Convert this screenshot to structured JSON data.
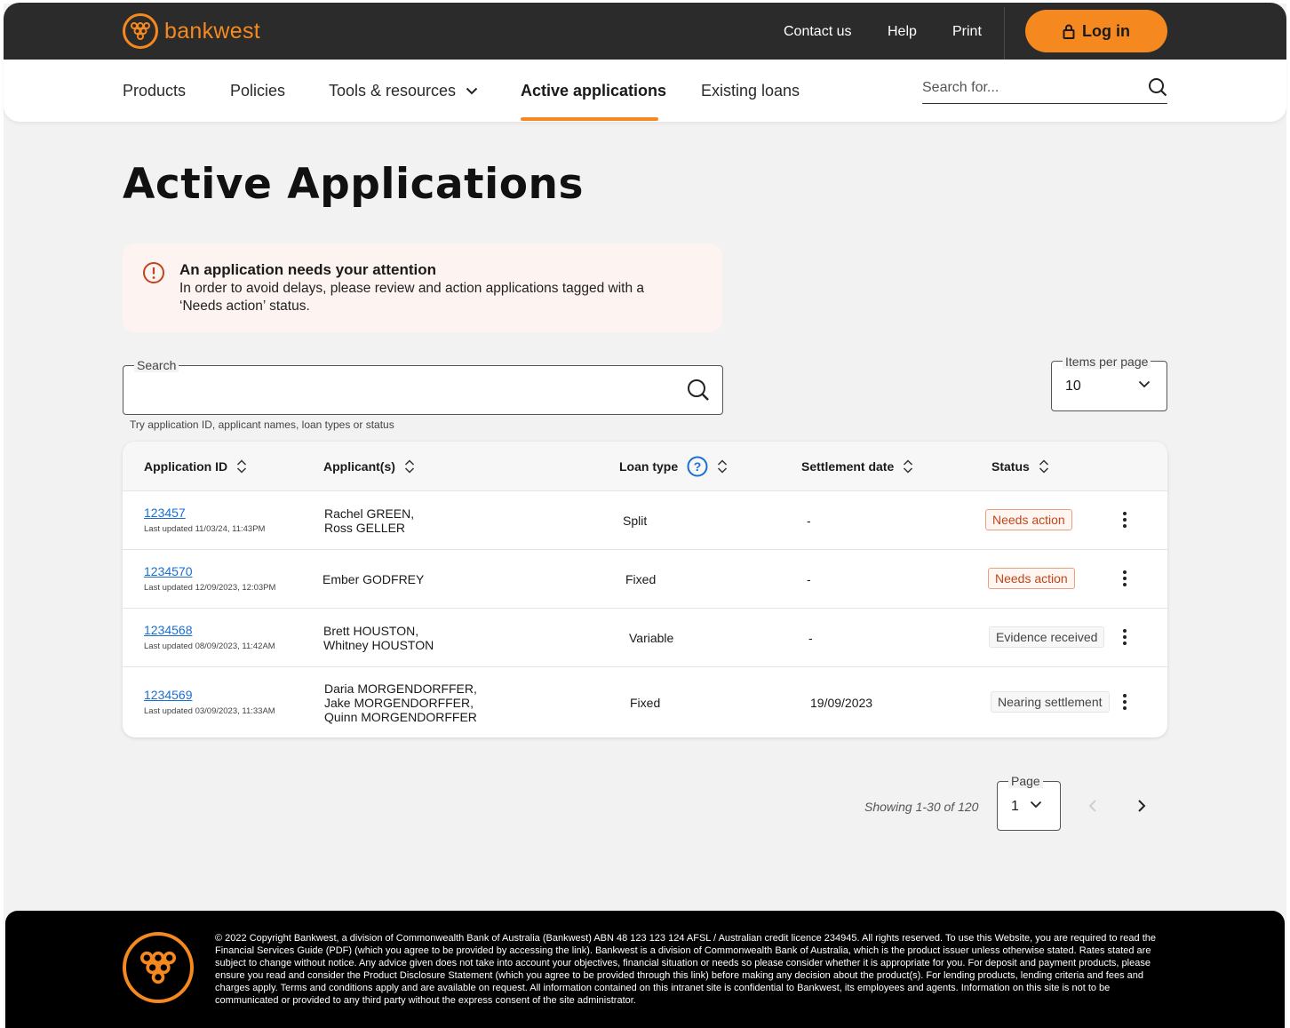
{
  "brand": {
    "name": "bankwest",
    "accent": "#f5891f"
  },
  "header": {
    "links": [
      "Contact us",
      "Help",
      "Print"
    ],
    "login_label": "Log in"
  },
  "nav": {
    "items": [
      "Products",
      "Policies",
      "Tools & resources",
      "Active applications",
      "Existing loans"
    ],
    "active": "Active applications",
    "search_placeholder": "Search for..."
  },
  "page_title": "Active Applications",
  "alert": {
    "title": "An application needs your attention",
    "body": "In order to avoid delays, please review and action applications tagged with a ‘Needs action’ status."
  },
  "search": {
    "label": "Search",
    "hint": "Try application ID, applicant names, loan types or status"
  },
  "items_per_page": {
    "label": "Items per page",
    "value": "10"
  },
  "table": {
    "headers": [
      "Application ID",
      "Applicant(s)",
      "Loan type",
      "Settlement date",
      "Status"
    ],
    "rows": [
      {
        "id": "123457",
        "updated": "Last updated 11/03/24, 11:43PM",
        "applicants": "Rachel GREEN,\nRoss GELLER",
        "loan_type": "Split",
        "settlement": "-",
        "status": "Needs action"
      },
      {
        "id": "1234570",
        "updated": "Last updated 12/09/2023, 12:03PM",
        "applicants": "Ember GODFREY",
        "loan_type": "Fixed",
        "settlement": "-",
        "status": "Needs action"
      },
      {
        "id": "1234568",
        "updated": "Last updated 08/09/2023, 11:42AM",
        "applicants": "Brett HOUSTON,\nWhitney HOUSTON",
        "loan_type": "Variable",
        "settlement": "-",
        "status": "Evidence received"
      },
      {
        "id": "1234569",
        "updated": "Last updated 03/09/2023, 11:33AM",
        "applicants": "Daria MORGENDORFFER,\nJake MORGENDORFFER,\nQuinn MORGENDORFFER",
        "loan_type": "Fixed",
        "settlement": "19/09/2023",
        "status": "Nearing settlement"
      }
    ]
  },
  "pagination": {
    "showing": "Showing 1-30 of 120",
    "page_label": "Page",
    "page_value": "1"
  },
  "footer": {
    "text": "© 2022 Copyright Bankwest, a division of Commonwealth Bank of Australia (Bankwest) ABN 48 123 123 124 AFSL / Australian credit licence 234945. All rights reserved. To use this Website, you are required to read the  Financial Services Guide (PDF)  (which you agree to be provided by accessing the link). Bankwest is a division of Commonwealth Bank of Australia, which is the product issuer unless otherwise stated. Rates stated are subject to change without notice. Any advice given does not take into account your objectives, financial situation or needs so please consider whether it is appropriate for you. For deposit and payment products, please ensure you read and consider the  Product Disclosure Statement  (which you agree to be provided through this link) before making any decision about the product(s). For lending products, lending criteria and fees and charges apply. Terms and conditions apply and are available on request. All information contained on this intranet site is confidential to Bankwest, its employees and agents. Information on this site is not to be communicated or provided to any third party without the express consent of the site administrator."
  }
}
